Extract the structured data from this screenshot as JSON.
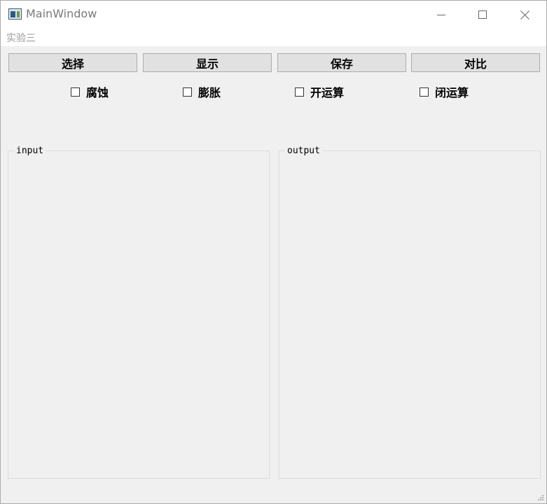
{
  "window": {
    "title": "MainWindow",
    "menu": [
      "实验三"
    ]
  },
  "toolbar": {
    "buttons": [
      "选择",
      "显示",
      "保存",
      "对比"
    ]
  },
  "operations": {
    "checkboxes": [
      {
        "label": "腐蚀",
        "checked": false
      },
      {
        "label": "膨胀",
        "checked": false
      },
      {
        "label": "开运算",
        "checked": false
      },
      {
        "label": "闭运算",
        "checked": false
      }
    ]
  },
  "panels": {
    "input_title": "input",
    "output_title": "output"
  },
  "icons": {
    "app": "app-window-icon",
    "minimize": "minimize-icon",
    "maximize": "maximize-icon",
    "close": "close-icon",
    "resize": "resize-grip-icon"
  }
}
